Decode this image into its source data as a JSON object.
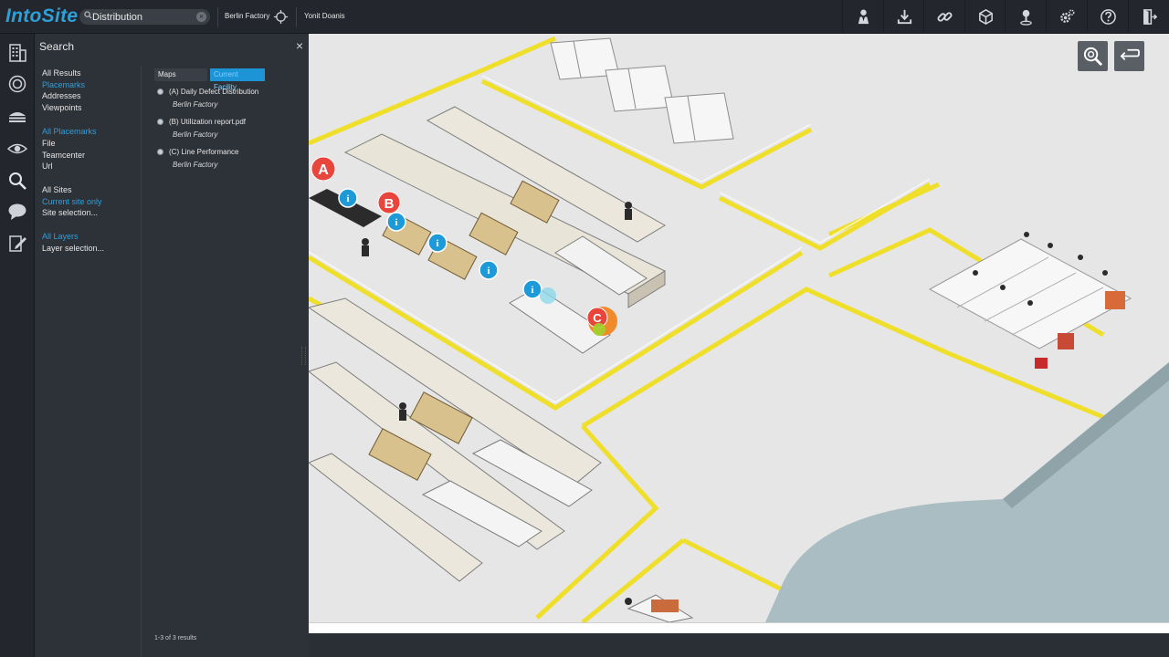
{
  "app": {
    "name": "IntoSite"
  },
  "search": {
    "value": "Distribution"
  },
  "site": {
    "label": "Berlin Factory"
  },
  "user": {
    "name": "Yonit Doanis"
  },
  "toolbar": {
    "icons": [
      "person-icon",
      "download-icon",
      "link-icon",
      "cube-icon",
      "map-pin-icon",
      "settings-icon",
      "help-icon",
      "exit-icon"
    ]
  },
  "rail": {
    "icons": [
      "building-icon",
      "target-icon",
      "layers-icon",
      "eye-icon",
      "search-icon",
      "comment-icon",
      "edit-icon"
    ]
  },
  "panel": {
    "title": "Search",
    "close": "×",
    "groups": [
      {
        "items": [
          {
            "label": "All Results",
            "active": false
          },
          {
            "label": "Placemarks",
            "active": true
          },
          {
            "label": "Addresses",
            "active": false
          },
          {
            "label": "Viewpoints",
            "active": false
          }
        ]
      },
      {
        "items": [
          {
            "label": "All Placemarks",
            "active": true
          },
          {
            "label": "File",
            "active": false
          },
          {
            "label": "Teamcenter",
            "active": false
          },
          {
            "label": "Url",
            "active": false
          }
        ]
      },
      {
        "items": [
          {
            "label": "All Sites",
            "active": false
          },
          {
            "label": "Current site only",
            "active": true
          },
          {
            "label": "Site selection...",
            "active": false
          }
        ]
      },
      {
        "items": [
          {
            "label": "All Layers",
            "active": true
          },
          {
            "label": "Layer selection...",
            "active": false
          }
        ]
      }
    ],
    "tabs": {
      "maps": "Maps",
      "current": "Current Facility"
    },
    "results": [
      {
        "title": "(A) Daily Defect Distribution",
        "site": "Berlin Factory"
      },
      {
        "title": "(B) Utilization report.pdf",
        "site": "Berlin Factory"
      },
      {
        "title": "(C) Line Performance",
        "site": "Berlin Factory"
      }
    ],
    "count": "1-3 of 3 results"
  },
  "map": {
    "placemarks": [
      {
        "letter": "A",
        "color": "#e8453c"
      },
      {
        "letter": "B",
        "color": "#e8453c"
      },
      {
        "letter": "C",
        "color": "#e8453c"
      }
    ],
    "info_symbol": "i",
    "floor_color": "#eaeaea",
    "lane_color": "#f2e12e"
  },
  "viewport_buttons": [
    "zoom-icon",
    "back-arrow-icon"
  ]
}
